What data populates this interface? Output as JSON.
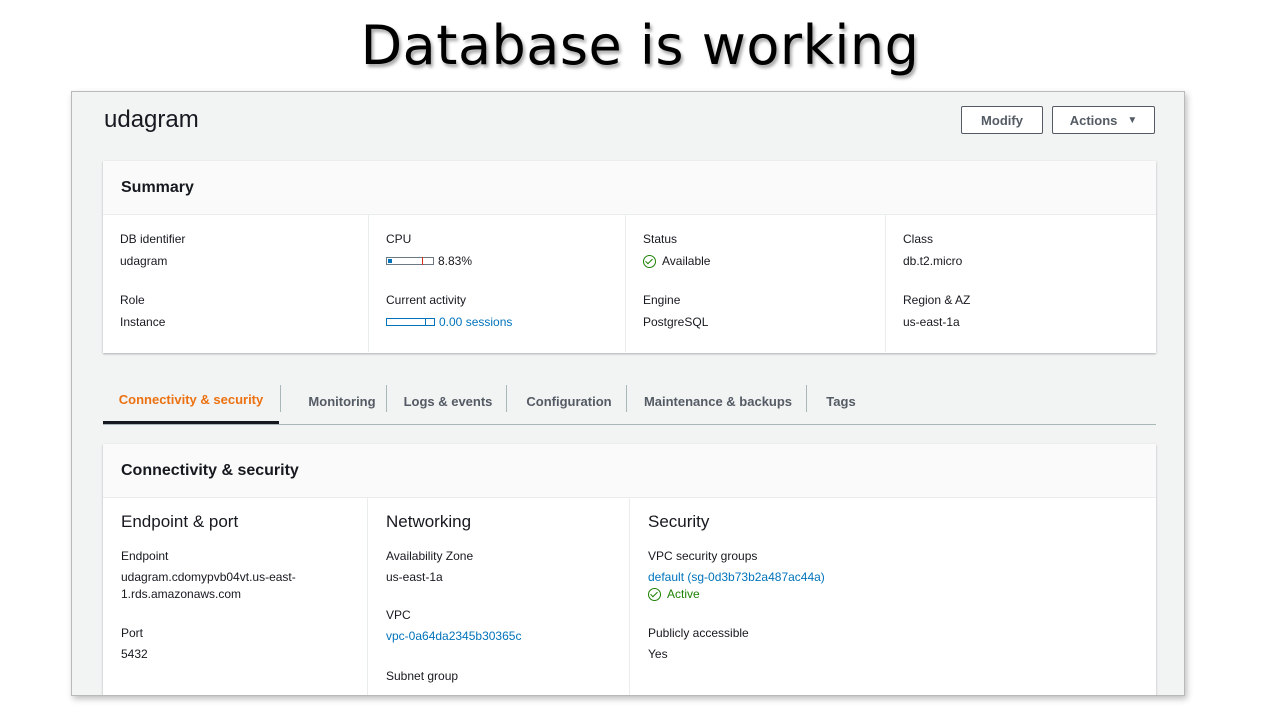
{
  "slide": {
    "title": "Database is working"
  },
  "header": {
    "db_name": "udagram",
    "modify_label": "Modify",
    "actions_label": "Actions",
    "actions_caret": "▼"
  },
  "summary": {
    "title": "Summary",
    "db_identifier_label": "DB identifier",
    "db_identifier": "udagram",
    "role_label": "Role",
    "role": "Instance",
    "cpu_label": "CPU",
    "cpu_value": "8.83%",
    "cpu_fraction": 0.0883,
    "activity_label": "Current activity",
    "activity_value": "0.00 sessions",
    "status_label": "Status",
    "status_value": "Available",
    "engine_label": "Engine",
    "engine_value": "PostgreSQL",
    "class_label": "Class",
    "class_value": "db.t2.micro",
    "region_label": "Region & AZ",
    "region_value": "us-east-1a"
  },
  "tabs": [
    {
      "label": "Connectivity & security",
      "active": true
    },
    {
      "label": "Monitoring",
      "active": false
    },
    {
      "label": "Logs & events",
      "active": false
    },
    {
      "label": "Configuration",
      "active": false
    },
    {
      "label": "Maintenance & backups",
      "active": false
    },
    {
      "label": "Tags",
      "active": false
    }
  ],
  "connectivity": {
    "title": "Connectivity & security",
    "endpoint_section": "Endpoint & port",
    "endpoint_label": "Endpoint",
    "endpoint_line1": "udagram.cdomypvb04vt.us-east-",
    "endpoint_line2": "1.rds.amazonaws.com",
    "port_label": "Port",
    "port_value": "5432",
    "networking_section": "Networking",
    "az_label": "Availability Zone",
    "az_value": "us-east-1a",
    "vpc_label": "VPC",
    "vpc_value": "vpc-0a64da2345b30365c",
    "subnet_label": "Subnet group",
    "security_section": "Security",
    "sg_label": "VPC security groups",
    "sg_value": "default (sg-0d3b73b2a487ac44a)",
    "sg_status": "Active",
    "public_label": "Publicly accessible",
    "public_value": "Yes"
  },
  "colors": {
    "link": "#0073bb",
    "success": "#1d8102",
    "active_tab": "#ec7211"
  }
}
